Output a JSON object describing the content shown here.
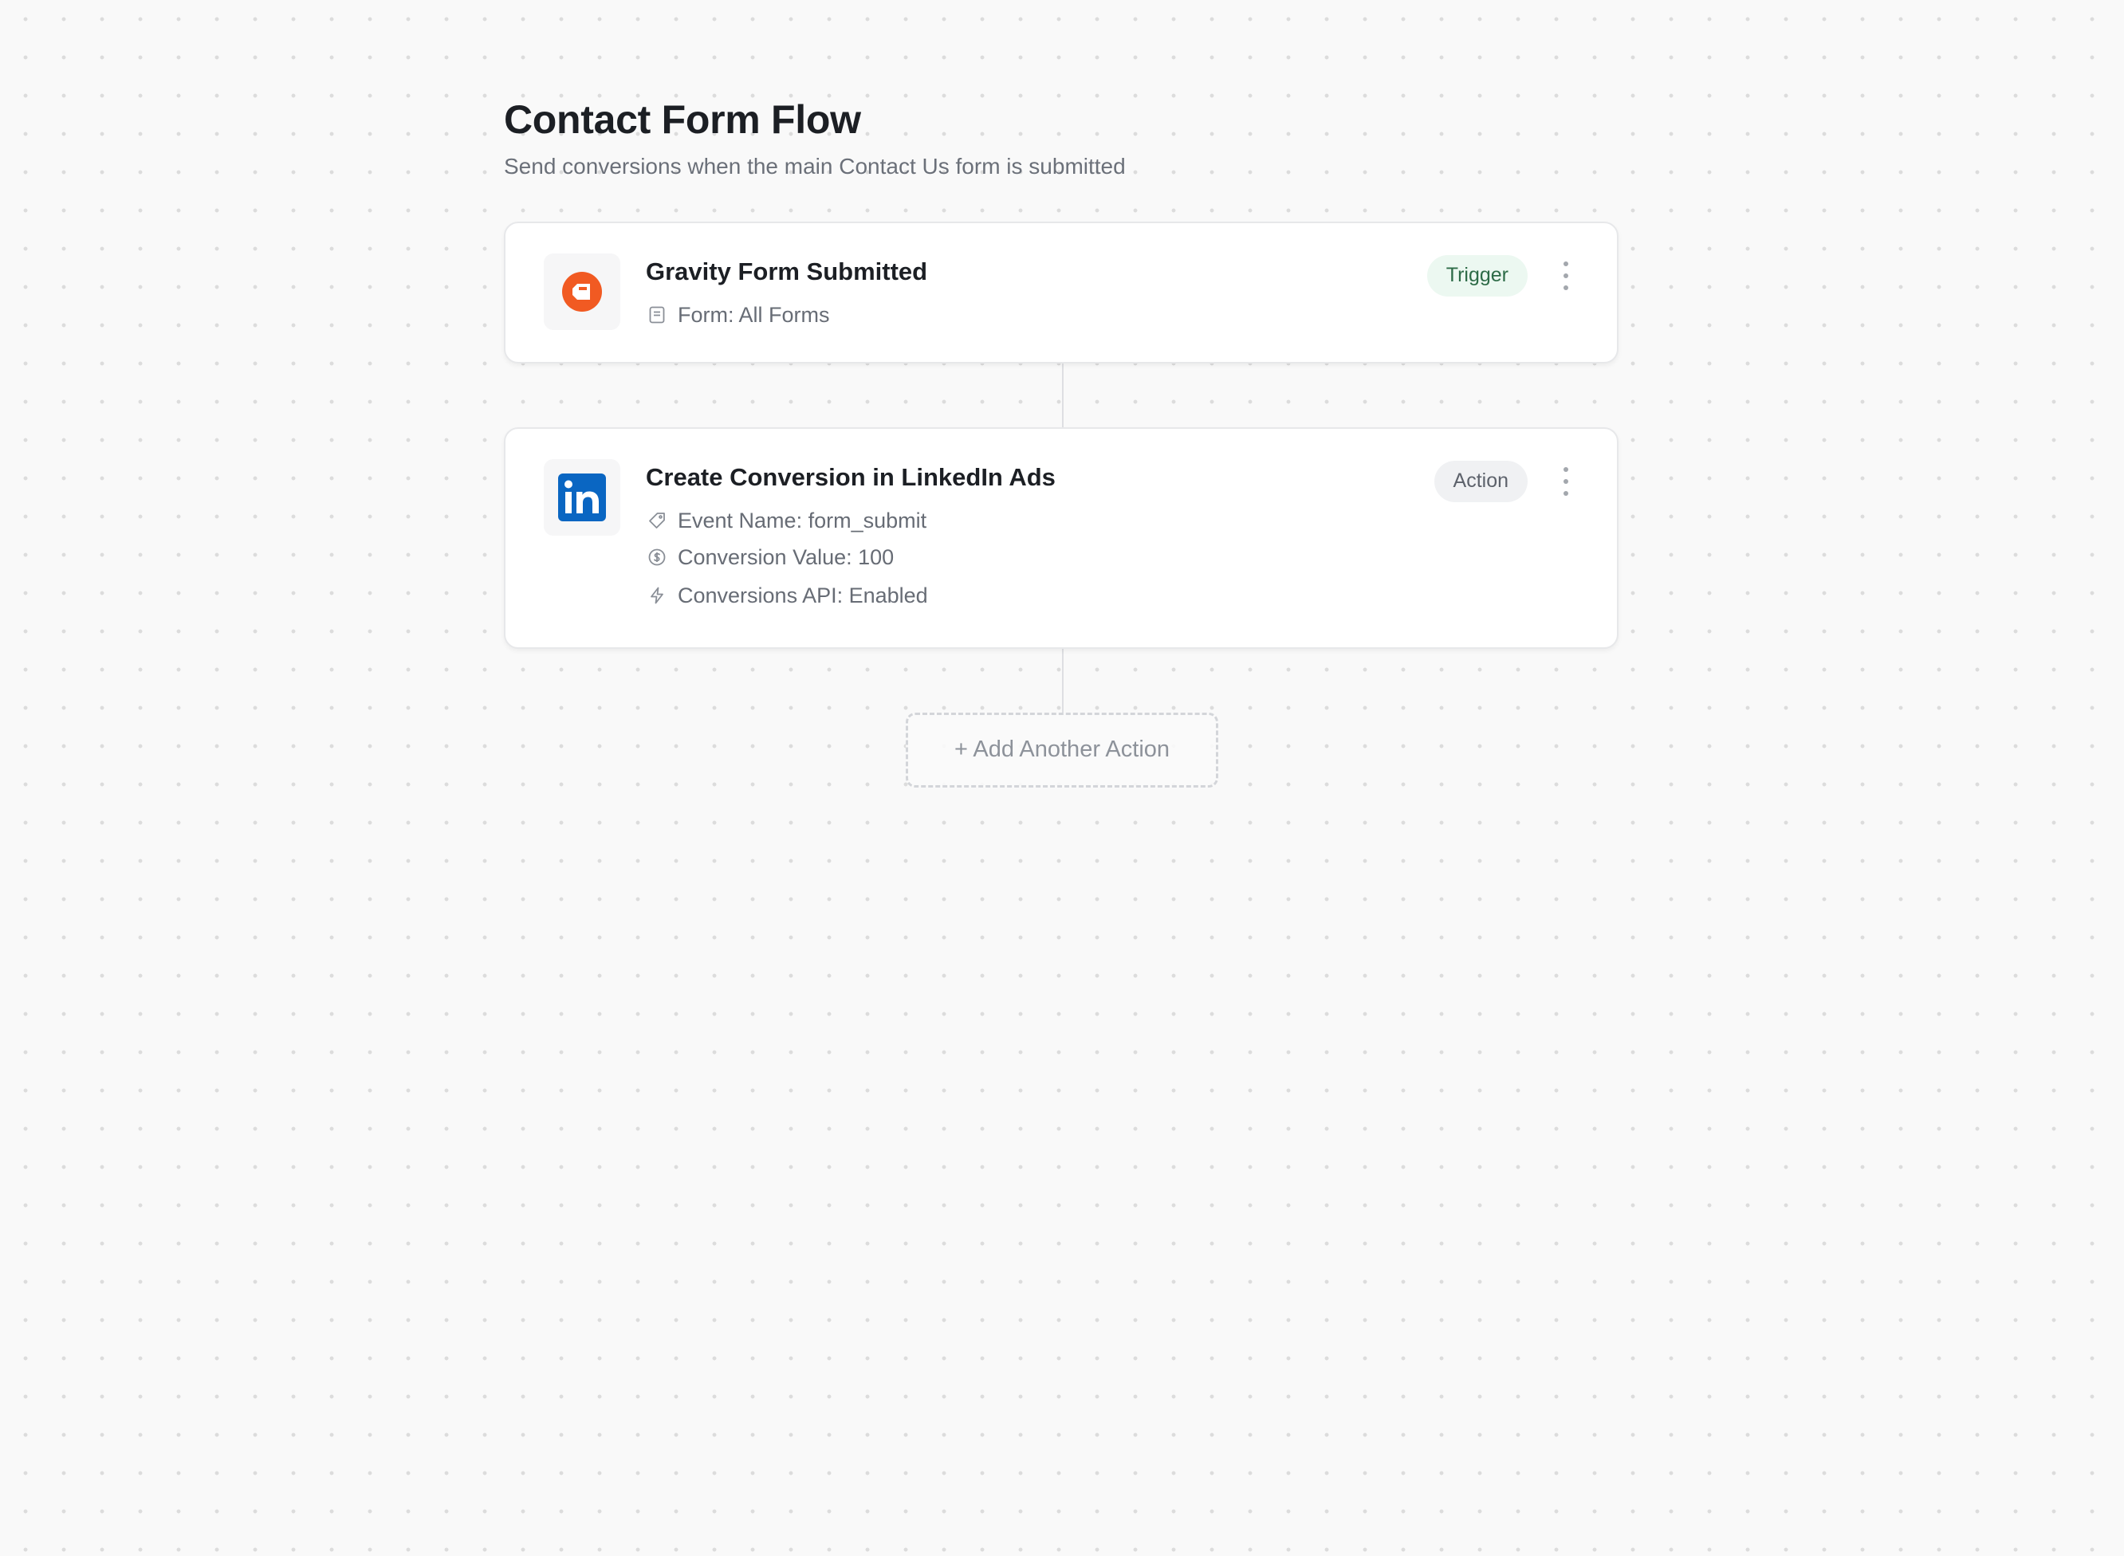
{
  "flow": {
    "title": "Contact Form Flow",
    "subtitle": "Send conversions when the main Contact Us form is submitted"
  },
  "trigger": {
    "title": "Gravity Form Submitted",
    "badge": "Trigger",
    "logo": "gravity-forms-logo",
    "details": [
      {
        "icon": "form-icon",
        "text": "Form: All Forms"
      }
    ]
  },
  "action": {
    "title": "Create Conversion in LinkedIn Ads",
    "badge": "Action",
    "logo": "linkedin-logo",
    "details": [
      {
        "icon": "tag-icon",
        "text": "Event Name: form_submit"
      },
      {
        "icon": "dollar-circle-icon",
        "text": "Conversion Value: 100"
      },
      {
        "icon": "lightning-icon",
        "text": "Conversions API: Enabled"
      }
    ]
  },
  "add_action": {
    "label": "+ Add Another Action"
  },
  "colors": {
    "gravity_orange": "#f15a22",
    "linkedin_blue": "#0a66c2",
    "trigger_badge_bg": "#ecf8f1",
    "trigger_badge_text": "#2d6b47",
    "action_badge_bg": "#f0f1f3",
    "background": "#f9f9f9"
  }
}
